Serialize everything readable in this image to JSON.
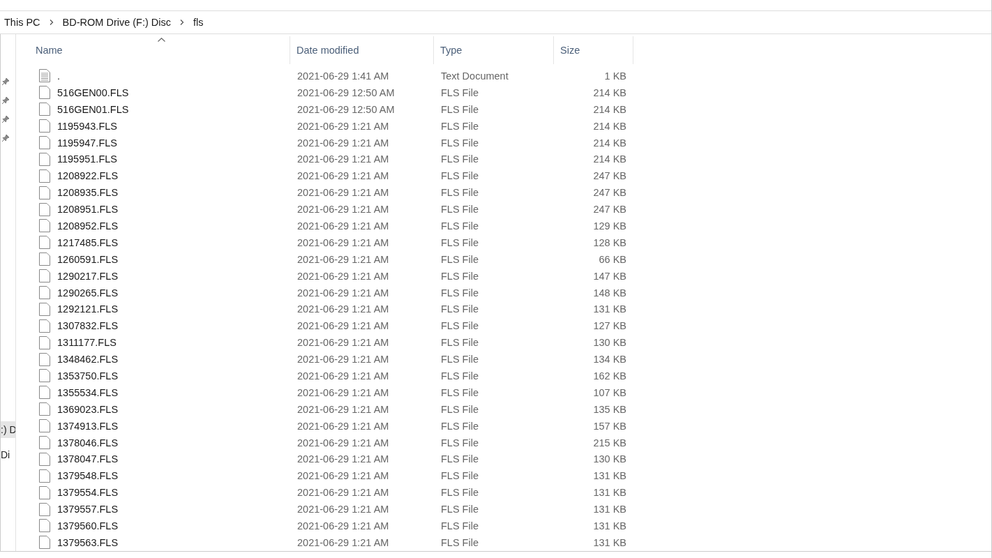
{
  "breadcrumb": [
    "This PC",
    "BD-ROM Drive (F:) Disc",
    "fls"
  ],
  "nav_pane": {
    "items": [
      {
        "label": ":) D",
        "selected": true
      },
      {
        "label": "Di",
        "selected": false
      }
    ]
  },
  "columns": [
    {
      "label": "Name",
      "sorted": true
    },
    {
      "label": "Date modified",
      "sorted": false
    },
    {
      "label": "Type",
      "sorted": false
    },
    {
      "label": "Size",
      "sorted": false
    }
  ],
  "rows": [
    {
      "kind": "text",
      "name": ".",
      "date": "2021-06-29 1:41 AM",
      "type": "Text Document",
      "size": "1 KB"
    },
    {
      "kind": "file",
      "name": "516GEN00.FLS",
      "date": "2021-06-29 12:50 AM",
      "type": "FLS File",
      "size": "214 KB"
    },
    {
      "kind": "file",
      "name": "516GEN01.FLS",
      "date": "2021-06-29 12:50 AM",
      "type": "FLS File",
      "size": "214 KB"
    },
    {
      "kind": "file",
      "name": "1195943.FLS",
      "date": "2021-06-29 1:21 AM",
      "type": "FLS File",
      "size": "214 KB"
    },
    {
      "kind": "file",
      "name": "1195947.FLS",
      "date": "2021-06-29 1:21 AM",
      "type": "FLS File",
      "size": "214 KB"
    },
    {
      "kind": "file",
      "name": "1195951.FLS",
      "date": "2021-06-29 1:21 AM",
      "type": "FLS File",
      "size": "214 KB"
    },
    {
      "kind": "file",
      "name": "1208922.FLS",
      "date": "2021-06-29 1:21 AM",
      "type": "FLS File",
      "size": "247 KB"
    },
    {
      "kind": "file",
      "name": "1208935.FLS",
      "date": "2021-06-29 1:21 AM",
      "type": "FLS File",
      "size": "247 KB"
    },
    {
      "kind": "file",
      "name": "1208951.FLS",
      "date": "2021-06-29 1:21 AM",
      "type": "FLS File",
      "size": "247 KB"
    },
    {
      "kind": "file",
      "name": "1208952.FLS",
      "date": "2021-06-29 1:21 AM",
      "type": "FLS File",
      "size": "129 KB"
    },
    {
      "kind": "file",
      "name": "1217485.FLS",
      "date": "2021-06-29 1:21 AM",
      "type": "FLS File",
      "size": "128 KB"
    },
    {
      "kind": "file",
      "name": "1260591.FLS",
      "date": "2021-06-29 1:21 AM",
      "type": "FLS File",
      "size": "66 KB"
    },
    {
      "kind": "file",
      "name": "1290217.FLS",
      "date": "2021-06-29 1:21 AM",
      "type": "FLS File",
      "size": "147 KB"
    },
    {
      "kind": "file",
      "name": "1290265.FLS",
      "date": "2021-06-29 1:21 AM",
      "type": "FLS File",
      "size": "148 KB"
    },
    {
      "kind": "file",
      "name": "1292121.FLS",
      "date": "2021-06-29 1:21 AM",
      "type": "FLS File",
      "size": "131 KB"
    },
    {
      "kind": "file",
      "name": "1307832.FLS",
      "date": "2021-06-29 1:21 AM",
      "type": "FLS File",
      "size": "127 KB"
    },
    {
      "kind": "file",
      "name": "1311177.FLS",
      "date": "2021-06-29 1:21 AM",
      "type": "FLS File",
      "size": "130 KB"
    },
    {
      "kind": "file",
      "name": "1348462.FLS",
      "date": "2021-06-29 1:21 AM",
      "type": "FLS File",
      "size": "134 KB"
    },
    {
      "kind": "file",
      "name": "1353750.FLS",
      "date": "2021-06-29 1:21 AM",
      "type": "FLS File",
      "size": "162 KB"
    },
    {
      "kind": "file",
      "name": "1355534.FLS",
      "date": "2021-06-29 1:21 AM",
      "type": "FLS File",
      "size": "107 KB"
    },
    {
      "kind": "file",
      "name": "1369023.FLS",
      "date": "2021-06-29 1:21 AM",
      "type": "FLS File",
      "size": "135 KB"
    },
    {
      "kind": "file",
      "name": "1374913.FLS",
      "date": "2021-06-29 1:21 AM",
      "type": "FLS File",
      "size": "157 KB"
    },
    {
      "kind": "file",
      "name": "1378046.FLS",
      "date": "2021-06-29 1:21 AM",
      "type": "FLS File",
      "size": "215 KB"
    },
    {
      "kind": "file",
      "name": "1378047.FLS",
      "date": "2021-06-29 1:21 AM",
      "type": "FLS File",
      "size": "130 KB"
    },
    {
      "kind": "file",
      "name": "1379548.FLS",
      "date": "2021-06-29 1:21 AM",
      "type": "FLS File",
      "size": "131 KB"
    },
    {
      "kind": "file",
      "name": "1379554.FLS",
      "date": "2021-06-29 1:21 AM",
      "type": "FLS File",
      "size": "131 KB"
    },
    {
      "kind": "file",
      "name": "1379557.FLS",
      "date": "2021-06-29 1:21 AM",
      "type": "FLS File",
      "size": "131 KB"
    },
    {
      "kind": "file",
      "name": "1379560.FLS",
      "date": "2021-06-29 1:21 AM",
      "type": "FLS File",
      "size": "131 KB"
    },
    {
      "kind": "file",
      "name": "1379563.FLS",
      "date": "2021-06-29 1:21 AM",
      "type": "FLS File",
      "size": "131 KB"
    }
  ]
}
